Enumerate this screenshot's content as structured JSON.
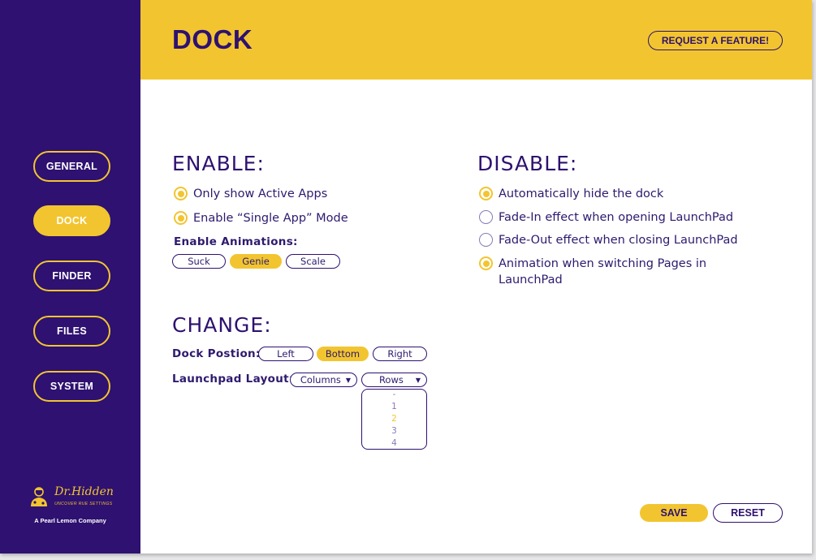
{
  "colors": {
    "sidebar": "#2e1170",
    "accent": "#f2c530",
    "text": "#2e1a6e",
    "radio_off": "#8a7ab5"
  },
  "sidebar": {
    "items": [
      {
        "label": "GENERAL",
        "active": false
      },
      {
        "label": "DOCK",
        "active": true
      },
      {
        "label": "FINDER",
        "active": false
      },
      {
        "label": "FILES",
        "active": false
      },
      {
        "label": "SYSTEM",
        "active": false
      }
    ],
    "brand": {
      "name": "Dr.Hidden",
      "tagline": "UNCOVER RUE SETTINGS",
      "company": "A Pearl Lemon Company",
      "icon": "doctor-logo-icon"
    }
  },
  "header": {
    "title": "DOCK",
    "request_label": "REQUEST A FEATURE!"
  },
  "enable": {
    "title": "ENABLE:",
    "options": [
      {
        "label": "Only show Active Apps",
        "checked": true
      },
      {
        "label": "Enable “Single App” Mode",
        "checked": true
      }
    ],
    "animations_label": "Enable Animations:",
    "animations": [
      {
        "label": "Suck",
        "selected": false
      },
      {
        "label": "Genie",
        "selected": true
      },
      {
        "label": "Scale",
        "selected": false
      }
    ]
  },
  "disable": {
    "title": "DISABLE:",
    "options": [
      {
        "label": "Automatically hide the dock",
        "checked": true
      },
      {
        "label": "Fade-In effect when opening LaunchPad",
        "checked": false
      },
      {
        "label": "Fade-Out effect when closing LaunchPad",
        "checked": false
      },
      {
        "label": "Animation when switching Pages in LaunchPad",
        "checked": true
      }
    ]
  },
  "change": {
    "title": "CHANGE:",
    "dock_position_label": "Dock Postion:",
    "dock_positions": [
      {
        "label": "Left",
        "selected": false
      },
      {
        "label": "Bottom",
        "selected": true
      },
      {
        "label": "Right",
        "selected": false
      }
    ],
    "launchpad_label": "Launchpad Layout:",
    "columns_select": {
      "value": "Columns",
      "caret": "▼"
    },
    "rows_select": {
      "value": "Rows",
      "caret": "▼"
    },
    "rows_options": [
      {
        "label": "-",
        "selected": false
      },
      {
        "label": "1",
        "selected": false
      },
      {
        "label": "2",
        "selected": true
      },
      {
        "label": "3",
        "selected": false
      },
      {
        "label": "4",
        "selected": false
      }
    ]
  },
  "footer": {
    "save_label": "SAVE",
    "reset_label": "RESET"
  }
}
